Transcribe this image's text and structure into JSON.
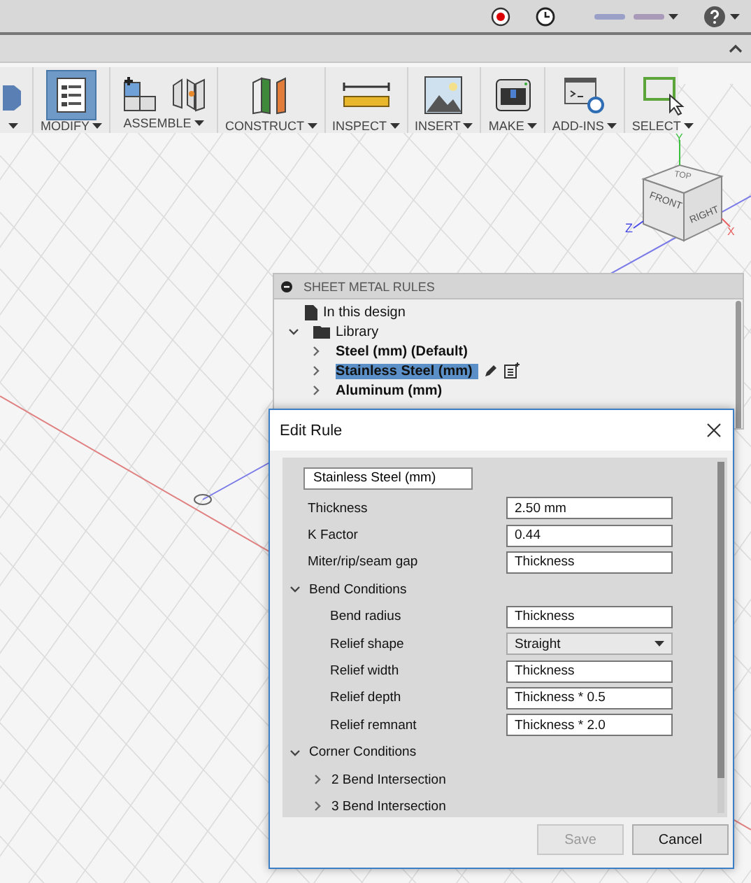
{
  "toolbar": {
    "groups": [
      {
        "selected": false
      },
      {
        "label": "MODIFY",
        "selected": true
      },
      {
        "label": "ASSEMBLE",
        "selected": false
      },
      {
        "label": "CONSTRUCT",
        "selected": false
      },
      {
        "label": "INSPECT",
        "selected": false
      },
      {
        "label": "INSERT",
        "selected": false
      },
      {
        "label": "MAKE",
        "selected": false
      },
      {
        "label": "ADD-INS",
        "selected": false
      },
      {
        "label": "SELECT",
        "selected": false
      }
    ]
  },
  "view_cube": {
    "faces": [
      "TOP",
      "FRONT",
      "RIGHT"
    ],
    "axes": [
      "Y",
      "Z",
      "X"
    ]
  },
  "rules_panel": {
    "title": "SHEET METAL RULES",
    "items": [
      {
        "kind": "document",
        "label": "In this design"
      },
      {
        "kind": "folder",
        "label": "Library",
        "expanded": true,
        "children": [
          {
            "kind": "rule",
            "label": "Steel (mm) (Default)",
            "expanded": false,
            "selected": false
          },
          {
            "kind": "rule",
            "label": "Stainless Steel (mm)",
            "expanded": false,
            "selected": true
          },
          {
            "kind": "rule",
            "label": "Aluminum (mm)",
            "expanded": false,
            "selected": false
          }
        ]
      }
    ]
  },
  "dialog": {
    "title": "Edit Rule",
    "name_value": "Stainless Steel (mm)",
    "rows": [
      {
        "kind": "field",
        "label": "Thickness",
        "value": "2.50 mm"
      },
      {
        "kind": "field",
        "label": "K Factor",
        "value": "0.44"
      },
      {
        "kind": "field",
        "label": "Miter/rip/seam gap",
        "value": "Thickness"
      },
      {
        "kind": "section",
        "label": "Bend Conditions",
        "expanded": true,
        "children": [
          {
            "kind": "field",
            "label": "Bend radius",
            "value": "Thickness"
          },
          {
            "kind": "dropdown",
            "label": "Relief shape",
            "value": "Straight"
          },
          {
            "kind": "field",
            "label": "Relief width",
            "value": "Thickness"
          },
          {
            "kind": "field",
            "label": "Relief depth",
            "value": "Thickness * 0.5"
          },
          {
            "kind": "field",
            "label": "Relief remnant",
            "value": "Thickness * 2.0"
          }
        ]
      },
      {
        "kind": "section",
        "label": "Corner Conditions",
        "expanded": true,
        "children": [
          {
            "kind": "section",
            "label": "2 Bend Intersection",
            "expanded": false
          },
          {
            "kind": "section",
            "label": "3 Bend Intersection",
            "expanded": false
          }
        ]
      }
    ],
    "buttons": [
      {
        "label": "Save",
        "disabled": true
      },
      {
        "label": "Cancel",
        "disabled": false
      }
    ]
  }
}
